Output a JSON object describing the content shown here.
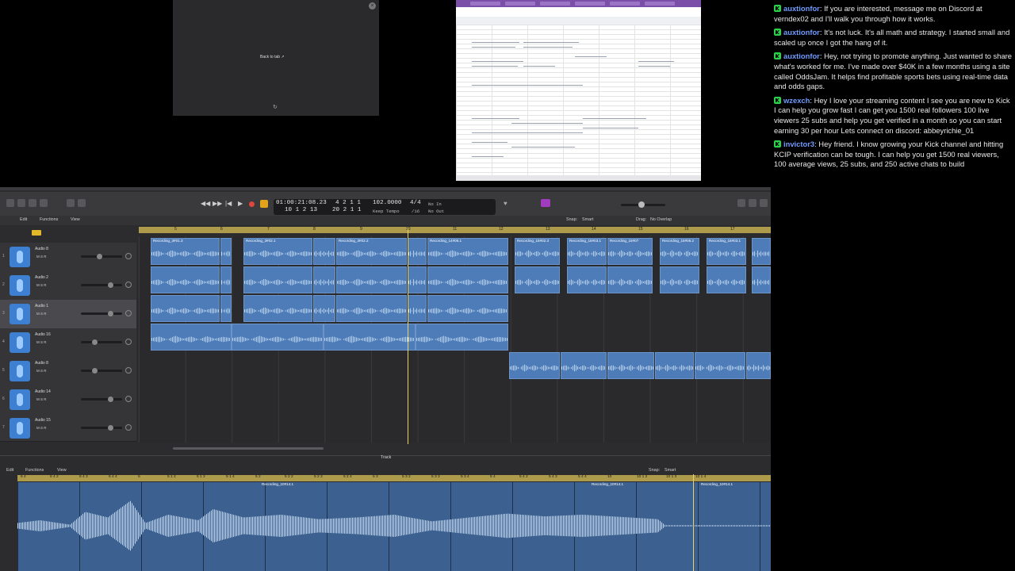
{
  "preview": {
    "back_label": "Back to tab"
  },
  "chat": {
    "messages": [
      {
        "user": "auxtionfor",
        "text": "If you are interested, message me on Discord at verndex02 and I'll walk you through how it works."
      },
      {
        "user": "auxtionfor",
        "text": "It's not luck. It's all math and strategy. I started small and scaled up once I got the hang of it."
      },
      {
        "user": "auxtionfor",
        "text": "Hey, not trying to promote anything. Just wanted to share what's worked for me. I've made over $40K in a few months using a site called OddsJam. It helps find profitable sports bets using real-time data and odds gaps."
      },
      {
        "user": "wzexch",
        "text": "Hey I love your streaming content I see you are new to Kick I can help you grow fast I can get you 1500 real followers 100 live viewers 25 subs and help you get verified in a month so you can start earning 30 per hour Lets connect on discord: abbeyrichie_01"
      },
      {
        "user": "invictor3",
        "text": "Hey friend. I know growing your Kick channel and hitting KCIP verification can be tough. I can help you get 1500 real viewers, 100 average views, 25 subs, and 250 active chats to build"
      }
    ]
  },
  "daw": {
    "lcd": {
      "time": "01:00:21:08.23",
      "bars": "10  1  2   13",
      "position": "4  2  1     1",
      "position2": "20  2  1     1",
      "tempo": "102.0000",
      "tempo_mode": "Keep Tempo",
      "signature": "4/4",
      "division": "/16",
      "in_label": "No In",
      "out_label": "No Out"
    },
    "menu": {
      "edit": "Edit",
      "functions": "Functions",
      "view": "View",
      "snap_label": "Snap:",
      "snap_value": "Smart",
      "drag_label": "Drag:",
      "drag_value": "No Overlap"
    },
    "ruler": [
      "5",
      "6",
      "7",
      "8",
      "9",
      "10",
      "11",
      "12",
      "13",
      "14",
      "15",
      "16",
      "17"
    ],
    "tracks": [
      {
        "num": "1",
        "name": "Audio 8"
      },
      {
        "num": "2",
        "name": "Audio 2"
      },
      {
        "num": "3",
        "name": "Audio 1"
      },
      {
        "num": "4",
        "name": "Audio 16"
      },
      {
        "num": "5",
        "name": "Audio 8"
      },
      {
        "num": "6",
        "name": "Audio 14"
      },
      {
        "num": "7",
        "name": "Audio 15"
      }
    ],
    "regions": [
      "Recording_3#01.3",
      "Recording_3#02.1",
      "Recording_3#02.2",
      "Recording_14#06.1",
      "Recording_15#02.3",
      "Recording_15#03.1",
      "Recording_15#07",
      "Recording_15#06.2",
      "Recording_15#03.1"
    ],
    "editor": {
      "title": "Track",
      "edit": "Edit",
      "functions": "Functions",
      "view": "View",
      "snap_label": "Snap:",
      "snap_value": "Smart",
      "ruler": [
        "6 4",
        "6 4 2",
        "6 4 3",
        "6 4 4",
        "5",
        "5 1 2",
        "5 1 3",
        "5 1 4",
        "5 2",
        "5 2 2",
        "5 2 3",
        "5 2 4",
        "5 3",
        "5 3 2",
        "5 3 3",
        "5 3 4",
        "5 4",
        "5 4 2",
        "5 4 3",
        "5 4 4",
        "10",
        "10 1 2",
        "10 1 3",
        "10 1 4"
      ],
      "segments": [
        "Recording_10#14.1",
        "Recording_10#14.1",
        "Recording_10#14.1"
      ]
    }
  }
}
